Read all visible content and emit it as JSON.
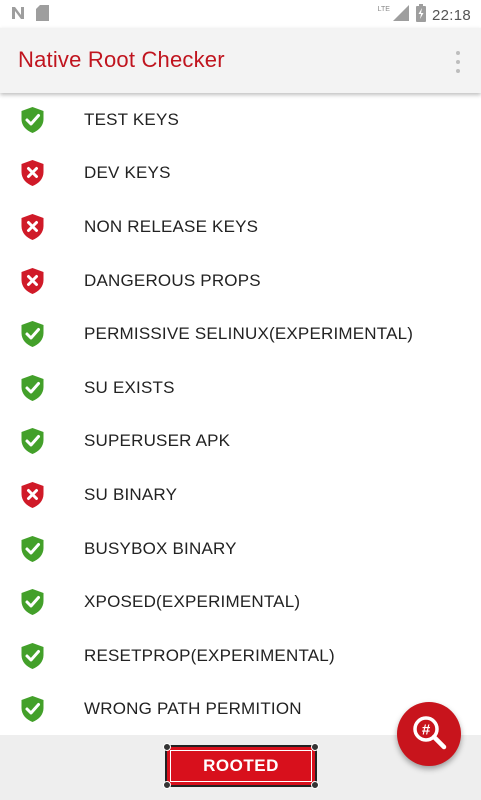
{
  "status_bar": {
    "time": "22:18",
    "network_label": "LTE",
    "left_icons": [
      "n-logo-icon",
      "sd-card-icon"
    ],
    "right_icons": [
      "signal-icon",
      "battery-icon"
    ]
  },
  "toolbar": {
    "title": "Native Root Checker",
    "title_color": "#c0141e"
  },
  "checks": [
    {
      "label": "TEST KEYS",
      "status": "pass"
    },
    {
      "label": "DEV KEYS",
      "status": "fail"
    },
    {
      "label": "NON RELEASE KEYS",
      "status": "fail"
    },
    {
      "label": "DANGEROUS PROPS",
      "status": "fail"
    },
    {
      "label": "PERMISSIVE SELINUX(EXPERIMENTAL)",
      "status": "pass"
    },
    {
      "label": "SU EXISTS",
      "status": "pass"
    },
    {
      "label": "SUPERUSER APK",
      "status": "pass"
    },
    {
      "label": "SU BINARY",
      "status": "fail"
    },
    {
      "label": "BUSYBOX BINARY",
      "status": "pass"
    },
    {
      "label": "XPOSED(EXPERIMENTAL)",
      "status": "pass"
    },
    {
      "label": "RESETPROP(EXPERIMENTAL)",
      "status": "pass"
    },
    {
      "label": "WRONG PATH PERMITION",
      "status": "pass"
    }
  ],
  "colors": {
    "pass": "#43a02a",
    "fail": "#d01a28",
    "accent": "#c8141c"
  },
  "result": {
    "label": "ROOTED"
  },
  "fab": {
    "icon": "root-search-icon",
    "glyph": "#"
  }
}
